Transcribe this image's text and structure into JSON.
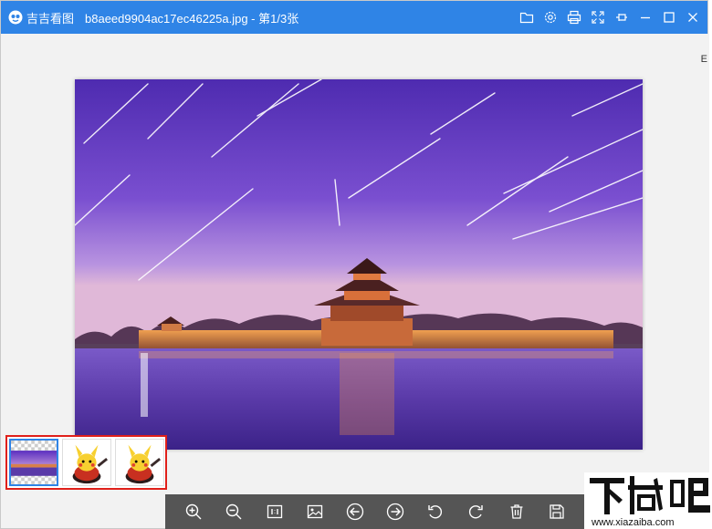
{
  "window": {
    "app_name": "吉吉看图",
    "file_title": "b8aeed9904ac17ec46225a.jpg - 第1/3张"
  },
  "titlebar_controls": [
    "folder-icon",
    "settings-icon",
    "print-icon",
    "fullscreen-icon",
    "pin-icon",
    "minimize-icon",
    "maximize-icon",
    "close-icon"
  ],
  "edge_text": "E",
  "thumbnails": [
    {
      "name": "thumb-palace-night",
      "active": true
    },
    {
      "name": "thumb-pikachu-1",
      "active": false
    },
    {
      "name": "thumb-pikachu-2",
      "active": false
    }
  ],
  "toolbar": [
    "zoom-in-icon",
    "zoom-out-icon",
    "actual-size-icon",
    "fit-image-icon",
    "prev-icon",
    "next-icon",
    "rotate-left-icon",
    "rotate-right-icon",
    "delete-icon",
    "save-icon"
  ],
  "watermark": {
    "brand": "下载吧",
    "url": "www.xiazaiba.com"
  },
  "colors": {
    "titlebar": "#2f84e6",
    "toolbar": "#555555",
    "highlight": "#e0201a",
    "sky_top": "#5b2fc0",
    "sky_bottom": "#b48ad8"
  }
}
